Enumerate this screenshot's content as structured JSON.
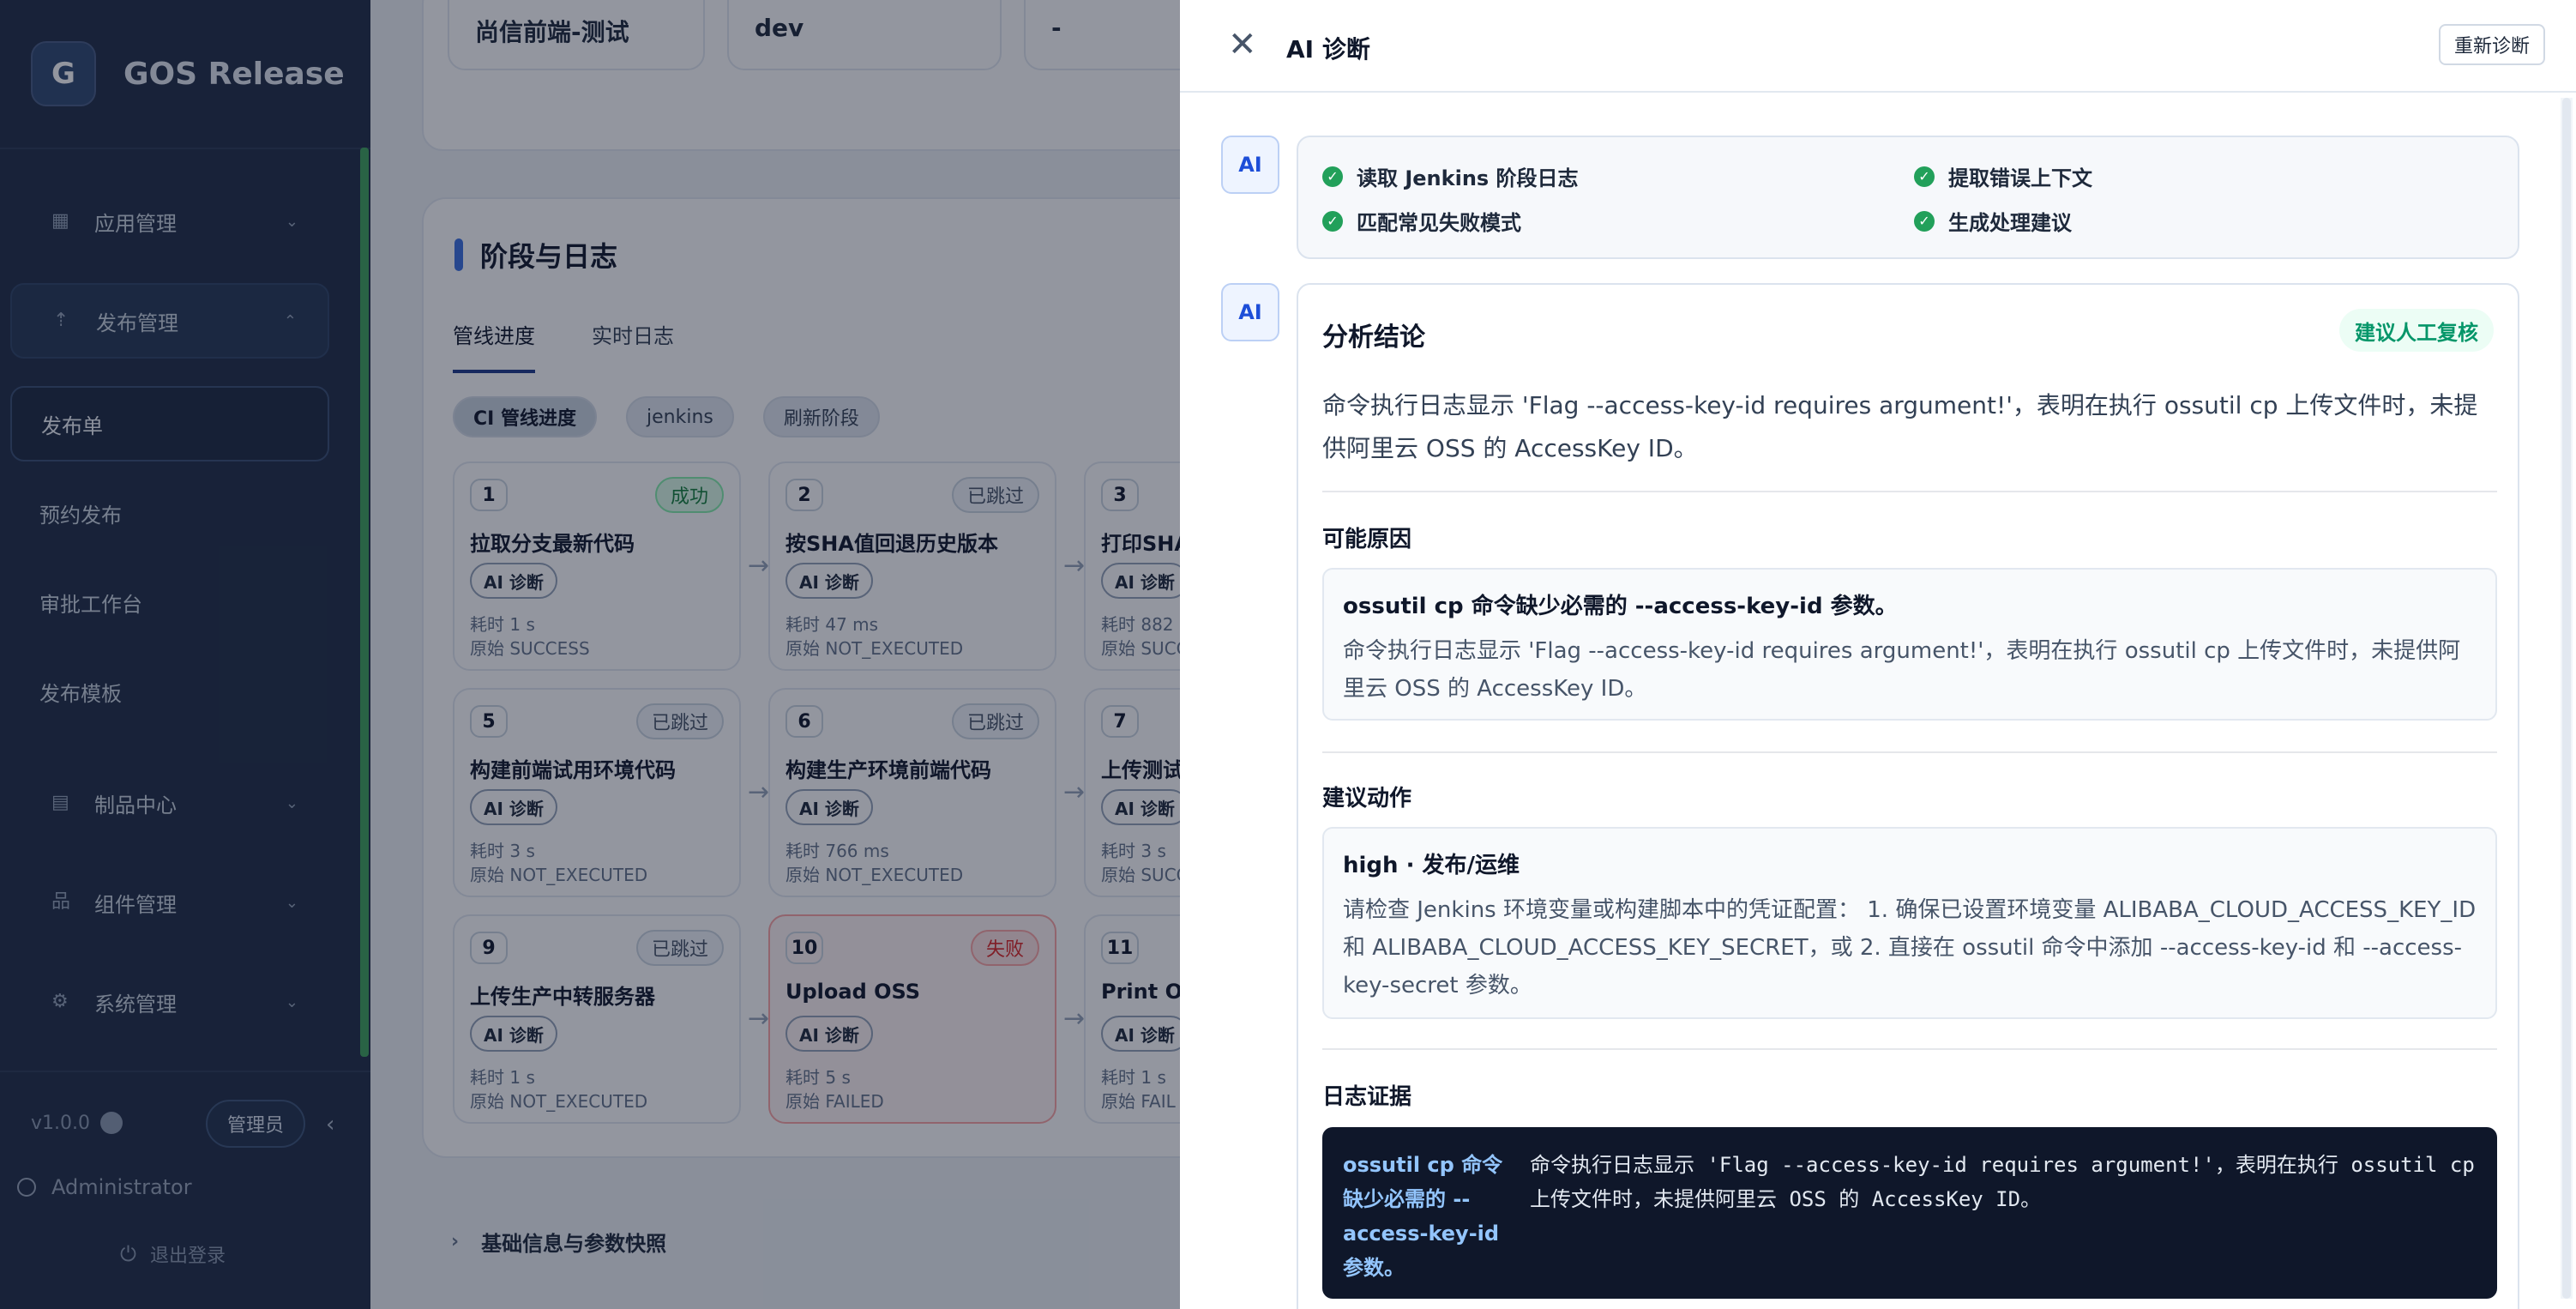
{
  "app": {
    "logo_letter": "G",
    "title": "GOS Release"
  },
  "sidebar": {
    "groups": [
      {
        "label": "应用管理",
        "icon": "grid-icon"
      },
      {
        "label": "发布管理",
        "icon": "rocket-icon"
      },
      {
        "label": "制品中心",
        "icon": "archive-icon"
      },
      {
        "label": "组件管理",
        "icon": "components-icon"
      },
      {
        "label": "系统管理",
        "icon": "gear-icon"
      }
    ],
    "sub_items": [
      "发布单",
      "预约发布",
      "审批工作台",
      "发布模板"
    ],
    "version": "v1.0.0",
    "role": "管理员",
    "user": "Administrator",
    "logout": "退出登录"
  },
  "main": {
    "info_values": [
      "尚信前端-测试",
      "dev",
      "-"
    ],
    "panel_title": "阶段与日志",
    "tabs": [
      "管线进度",
      "实时日志"
    ],
    "chips": [
      "CI 管线进度",
      "jenkins",
      "刷新阶段"
    ],
    "stages": [
      {
        "num": "1",
        "status": "成功",
        "name": "拉取分支最新代码",
        "ai": "AI 诊断",
        "time": "耗时 1 s",
        "origin": "原始 SUCCESS"
      },
      {
        "num": "2",
        "status": "已跳过",
        "name": "按SHA值回退历史版本",
        "ai": "AI 诊断",
        "time": "耗时 47 ms",
        "origin": "原始 NOT_EXECUTED"
      },
      {
        "num": "3",
        "status": "",
        "name": "打印SHA",
        "ai": "AI 诊断",
        "time": "耗时 882",
        "origin": "原始 SUCC"
      },
      {
        "num": "5",
        "status": "已跳过",
        "name": "构建前端试用环境代码",
        "ai": "AI 诊断",
        "time": "耗时 3 s",
        "origin": "原始 NOT_EXECUTED"
      },
      {
        "num": "6",
        "status": "已跳过",
        "name": "构建生产环境前端代码",
        "ai": "AI 诊断",
        "time": "耗时 766 ms",
        "origin": "原始 NOT_EXECUTED"
      },
      {
        "num": "7",
        "status": "",
        "name": "上传测试",
        "ai": "AI 诊断",
        "time": "耗时 3 s",
        "origin": "原始 SUCC"
      },
      {
        "num": "9",
        "status": "已跳过",
        "name": "上传生产中转服务器",
        "ai": "AI 诊断",
        "time": "耗时 1 s",
        "origin": "原始 NOT_EXECUTED"
      },
      {
        "num": "10",
        "status": "失败",
        "name": "Upload OSS",
        "ai": "AI 诊断",
        "time": "耗时 5 s",
        "origin": "原始 FAILED"
      },
      {
        "num": "11",
        "status": "",
        "name": "Print OS",
        "ai": "AI 诊断",
        "time": "耗时 1 s",
        "origin": "原始 FAIL"
      }
    ],
    "base_section": "基础信息与参数快照"
  },
  "drawer": {
    "title": "AI 诊断",
    "rediagnose": "重新诊断",
    "avatar": "AI",
    "steps": [
      "读取 Jenkins 阶段日志",
      "提取错误上下文",
      "匹配常见失败模式",
      "生成处理建议"
    ],
    "conclusion_title": "分析结论",
    "review_badge": "建议人工复核",
    "summary": "命令执行日志显示 'Flag --access-key-id requires argument!'，表明在执行 ossutil cp 上传文件时，未提供阿里云 OSS 的 AccessKey ID。",
    "cause_title": "可能原因",
    "cause_head": "ossutil cp 命令缺少必需的 --access-key-id 参数。",
    "cause_body": "命令执行日志显示 'Flag --access-key-id requires argument!'，表明在执行 ossutil cp 上传文件时，未提供阿里云 OSS 的 AccessKey ID。",
    "action_title": "建议动作",
    "action_head": "high · 发布/运维",
    "action_body": "请检查 Jenkins 环境变量或构建脚本中的凭证配置： 1. 确保已设置环境变量 ALIBABA_CLOUD_ACCESS_KEY_ID 和 ALIBABA_CLOUD_ACCESS_KEY_SECRET，或 2. 直接在 ossutil 命令中添加 --access-key-id 和 --access-key-secret 参数。",
    "evidence_title": "日志证据",
    "evidence_label": "ossutil cp 命令缺少必需的 --access-key-id 参数。",
    "evidence_text": "命令执行日志显示 'Flag --access-key-id requires argument!'，表明在执行 ossutil cp 上传文件时，未提供阿里云 OSS 的 AccessKey ID。"
  }
}
